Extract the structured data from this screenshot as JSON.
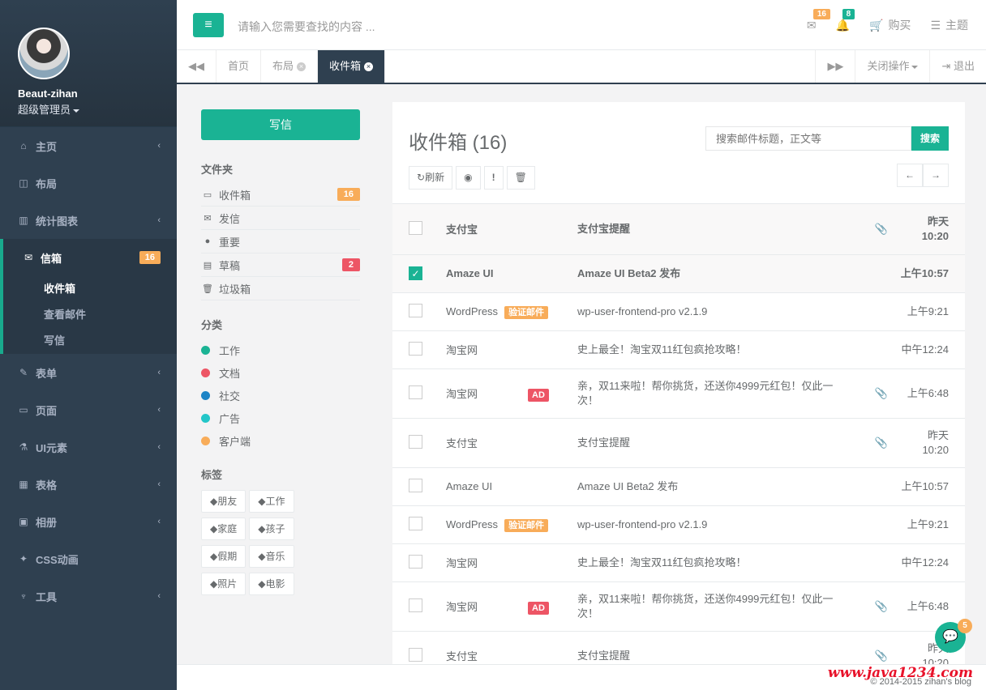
{
  "profile": {
    "name": "Beaut-zihan",
    "role": "超级管理员"
  },
  "nav": {
    "home": "主页",
    "layout": "布局",
    "charts": "统计图表",
    "mailbox": "信箱",
    "mailbox_badge": "16",
    "sub_inbox": "收件箱",
    "sub_view": "查看邮件",
    "sub_compose": "写信",
    "forms": "表单",
    "pages": "页面",
    "ui": "UI元素",
    "tables": "表格",
    "gallery": "相册",
    "css": "CSS动画",
    "tools": "工具"
  },
  "topbar": {
    "search_placeholder": "请输入您需要查找的内容 ...",
    "mail_count": "16",
    "bell_count": "8",
    "cart": "购买",
    "theme": "主题",
    "mail_color": "#f8ac59",
    "bell_color": "#1ab394"
  },
  "tabs": {
    "home": "首页",
    "layout": "布局",
    "inbox": "收件箱",
    "close_ops": "关闭操作",
    "logout": "退出"
  },
  "left": {
    "compose": "写信",
    "folders_title": "文件夹",
    "folders": [
      {
        "icon": "inbox-icon",
        "label": "收件箱",
        "badge": "16",
        "color": "#f8ac59"
      },
      {
        "icon": "envelope-icon",
        "label": "发信"
      },
      {
        "icon": "certificate-icon",
        "label": "重要"
      },
      {
        "icon": "file-icon",
        "label": "草稿",
        "badge": "2",
        "color": "#ed5565"
      },
      {
        "icon": "trash-icon",
        "label": "垃圾箱"
      }
    ],
    "categories_title": "分类",
    "categories": [
      {
        "label": "工作",
        "color": "#1ab394"
      },
      {
        "label": "文档",
        "color": "#ed5565"
      },
      {
        "label": "社交",
        "color": "#1c84c6"
      },
      {
        "label": "广告",
        "color": "#23c6c8"
      },
      {
        "label": "客户端",
        "color": "#f8ac59"
      }
    ],
    "tags_title": "标签",
    "tags": [
      "朋友",
      "工作",
      "家庭",
      "孩子",
      "假期",
      "音乐",
      "照片",
      "电影"
    ]
  },
  "mail": {
    "title": "收件箱 (16)",
    "search_placeholder": "搜索邮件标题，正文等",
    "search_btn": "搜索",
    "refresh": "刷新",
    "rows": [
      {
        "from": "支付宝",
        "tag": "",
        "subject": "支付宝提醒",
        "attach": true,
        "time": "昨天 10:20",
        "unread": true,
        "checked": false,
        "h": 62
      },
      {
        "from": "Amaze UI",
        "tag": "",
        "subject": "Amaze UI Beta2 发布",
        "attach": false,
        "time": "上午10:57",
        "unread": true,
        "checked": true,
        "h": 47
      },
      {
        "from": "WordPress",
        "tag": "验证邮件",
        "tagcolor": "#f8ac59",
        "subject": "wp-user-frontend-pro v2.1.9",
        "attach": false,
        "time": "上午9:21",
        "unread": false,
        "checked": false,
        "h": 47
      },
      {
        "from": "淘宝网",
        "tag": "",
        "subject": "史上最全！淘宝双11红包疯抢攻略！",
        "attach": false,
        "time": "中午12:24",
        "unread": false,
        "checked": false,
        "h": 47
      },
      {
        "from": "淘宝网",
        "tag": "AD",
        "tagcolor": "#ed5565",
        "subject": "亲，双11来啦！帮你挑货，还送你4999元红包！仅此一次！",
        "attach": true,
        "time": "上午6:48",
        "unread": false,
        "checked": false,
        "h": 61
      },
      {
        "from": "支付宝",
        "tag": "",
        "subject": "支付宝提醒",
        "attach": true,
        "time": "昨天 10:20",
        "unread": false,
        "checked": false,
        "h": 61
      },
      {
        "from": "Amaze UI",
        "tag": "",
        "subject": "Amaze UI Beta2 发布",
        "attach": false,
        "time": "上午10:57",
        "unread": false,
        "checked": false,
        "h": 47
      },
      {
        "from": "WordPress",
        "tag": "验证邮件",
        "tagcolor": "#f8ac59",
        "subject": "wp-user-frontend-pro v2.1.9",
        "attach": false,
        "time": "上午9:21",
        "unread": false,
        "checked": false,
        "h": 47
      },
      {
        "from": "淘宝网",
        "tag": "",
        "subject": "史上最全！淘宝双11红包疯抢攻略！",
        "attach": false,
        "time": "中午12:24",
        "unread": false,
        "checked": false,
        "h": 47
      },
      {
        "from": "淘宝网",
        "tag": "AD",
        "tagcolor": "#ed5565",
        "subject": "亲，双11来啦！帮你挑货，还送你4999元红包！仅此一次！",
        "attach": true,
        "time": "上午6:48",
        "unread": false,
        "checked": false,
        "h": 61
      },
      {
        "from": "支付宝",
        "tag": "",
        "subject": "支付宝提醒",
        "attach": true,
        "time": "昨天 10:20",
        "unread": false,
        "checked": false,
        "h": 61
      }
    ]
  },
  "chat_count": "5",
  "footer": {
    "copyright": "© 2014-2015 zihan's blog",
    "watermark": "www.java1234.com"
  }
}
